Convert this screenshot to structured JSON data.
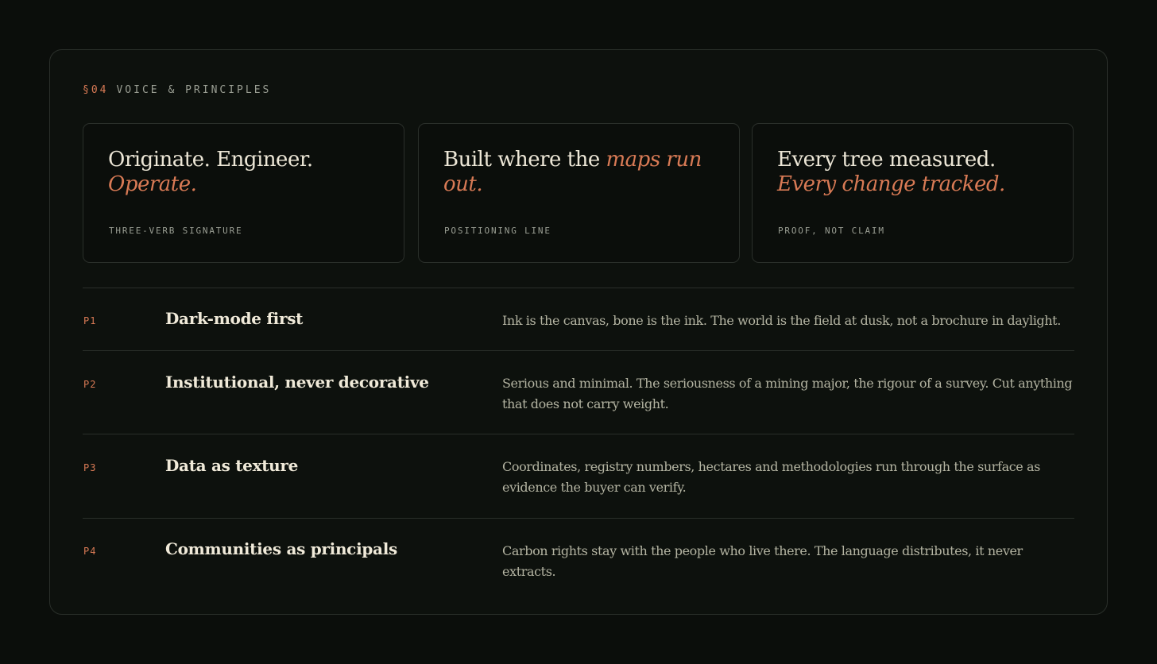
{
  "section": {
    "number": "§04",
    "title": "VOICE & PRINCIPLES"
  },
  "cards": [
    {
      "lead": "Originate. Engineer. ",
      "accent": "Operate.",
      "caption": "THREE-VERB SIGNATURE"
    },
    {
      "lead": "Built where the ",
      "accent": "maps run out.",
      "caption": "POSITIONING LINE"
    },
    {
      "lead": "Every tree measured. ",
      "accent": "Every change tracked.",
      "caption": "PROOF, NOT CLAIM"
    }
  ],
  "principles": [
    {
      "id": "P1",
      "title": "Dark-mode first",
      "body": "Ink is the canvas, bone is the ink. The world is the field at dusk, not a brochure in daylight."
    },
    {
      "id": "P2",
      "title": "Institutional, never decorative",
      "body": "Serious and minimal. The seriousness of a mining major, the rigour of a survey. Cut anything that does not carry weight."
    },
    {
      "id": "P3",
      "title": "Data as texture",
      "body": "Coordinates, registry numbers, hectares and methodologies run through the surface as evidence the buyer can verify."
    },
    {
      "id": "P4",
      "title": "Communities as principals",
      "body": "Carbon rights stay with the people who live there. The language distributes, it never extracts."
    }
  ],
  "colors": {
    "background": "#0b0e0b",
    "accent": "#d87a55",
    "text": "#ece6d6",
    "muted": "#9b9f94"
  }
}
